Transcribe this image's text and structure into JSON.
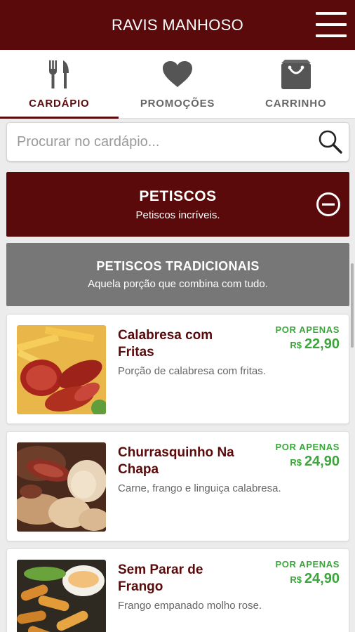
{
  "header": {
    "title": "RAVIS MANHOSO",
    "menu_icon": "hamburger-menu-icon"
  },
  "tabs": [
    {
      "label": "CARDÁPIO",
      "icon": "fork-knife-icon",
      "active": true
    },
    {
      "label": "PROMOÇÕES",
      "icon": "heart-icon",
      "active": false
    },
    {
      "label": "CARRINHO",
      "icon": "shopping-bag-icon",
      "active": false
    }
  ],
  "search": {
    "placeholder": "Procurar no cardápio...",
    "value": "",
    "icon": "search-icon"
  },
  "category": {
    "title": "PETISCOS",
    "subtitle": "Petiscos incríveis.",
    "icon": "minus-circle-icon"
  },
  "subcategory": {
    "title": "PETISCOS TRADICIONAIS",
    "description": "Aquela porção que combina com tudo."
  },
  "items": [
    {
      "name": "Calabresa com Fritas",
      "description": "Porção de calabresa com fritas.",
      "price_label": "POR APENAS",
      "currency": "R$",
      "price": "22,90"
    },
    {
      "name": "Churrasquinho Na Chapa",
      "description": "Carne, frango e linguiça calabresa.",
      "price_label": "POR APENAS",
      "currency": "R$",
      "price": "24,90"
    },
    {
      "name": "Sem Parar de Frango",
      "description": "Frango empanado molho rose.",
      "price_label": "POR APENAS",
      "currency": "R$",
      "price": "24,90"
    }
  ],
  "colors": {
    "brand": "#5a0a0a",
    "price": "#3ca53c",
    "subcategory_bg": "#777777"
  }
}
